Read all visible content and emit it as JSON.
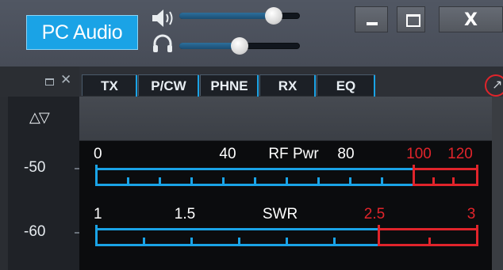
{
  "titlebar": {
    "pc_audio_label": "PC Audio",
    "speaker_volume": 0.78,
    "headphone_volume": 0.5,
    "close_label": "X"
  },
  "tabs": [
    {
      "label": "TX"
    },
    {
      "label": "P/CW"
    },
    {
      "label": "PHNE"
    },
    {
      "label": "RX"
    },
    {
      "label": "EQ"
    }
  ],
  "scale": {
    "labels": [
      "-50",
      "-60"
    ]
  },
  "meters": {
    "rf_pwr": {
      "name": "RF Pwr",
      "scale": [
        "0",
        "40",
        "80",
        "100",
        "120"
      ],
      "normal_color": "#1aa3e6",
      "warn_color": "#e0242b"
    },
    "swr": {
      "name": "SWR",
      "scale": [
        "1",
        "1.5",
        "2.5",
        "3"
      ],
      "normal_color": "#1aa3e6",
      "warn_color": "#e0242b"
    }
  }
}
